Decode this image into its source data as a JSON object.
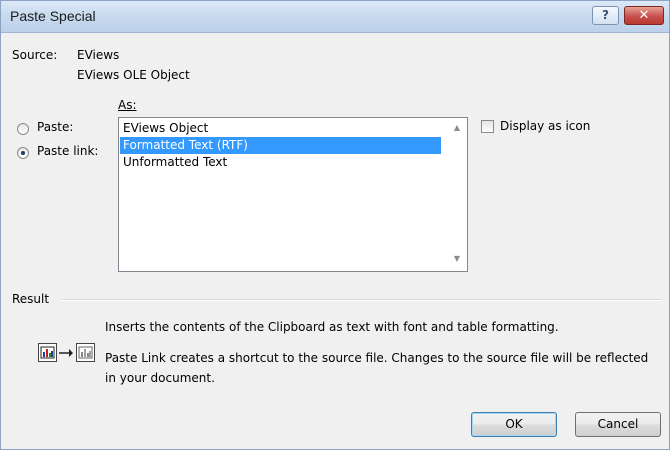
{
  "window": {
    "title": "Paste Special",
    "help_label": "?",
    "close_label": "✕"
  },
  "source": {
    "label": "Source:",
    "app": "EViews",
    "object": "EViews OLE Object"
  },
  "as_label": "As:",
  "options": {
    "paste": {
      "label": "Paste:",
      "selected": false
    },
    "paste_link": {
      "label": "Paste link:",
      "selected": true
    }
  },
  "formats": [
    {
      "label": "EViews Object",
      "selected": false
    },
    {
      "label": "Formatted Text (RTF)",
      "selected": true
    },
    {
      "label": "Unformatted Text",
      "selected": false
    }
  ],
  "display_as_icon": {
    "label": "Display as icon",
    "checked": false
  },
  "result": {
    "label": "Result",
    "line1": "Inserts the contents of the Clipboard as text with font and table formatting.",
    "line2": "Paste Link creates a shortcut to the source file. Changes to the source file will be reflected",
    "line3": "in your document."
  },
  "buttons": {
    "ok": "OK",
    "cancel": "Cancel"
  },
  "colors": {
    "selection": "#3399ff",
    "titlebar": "#c6d8ee",
    "close_button": "#c75050"
  }
}
